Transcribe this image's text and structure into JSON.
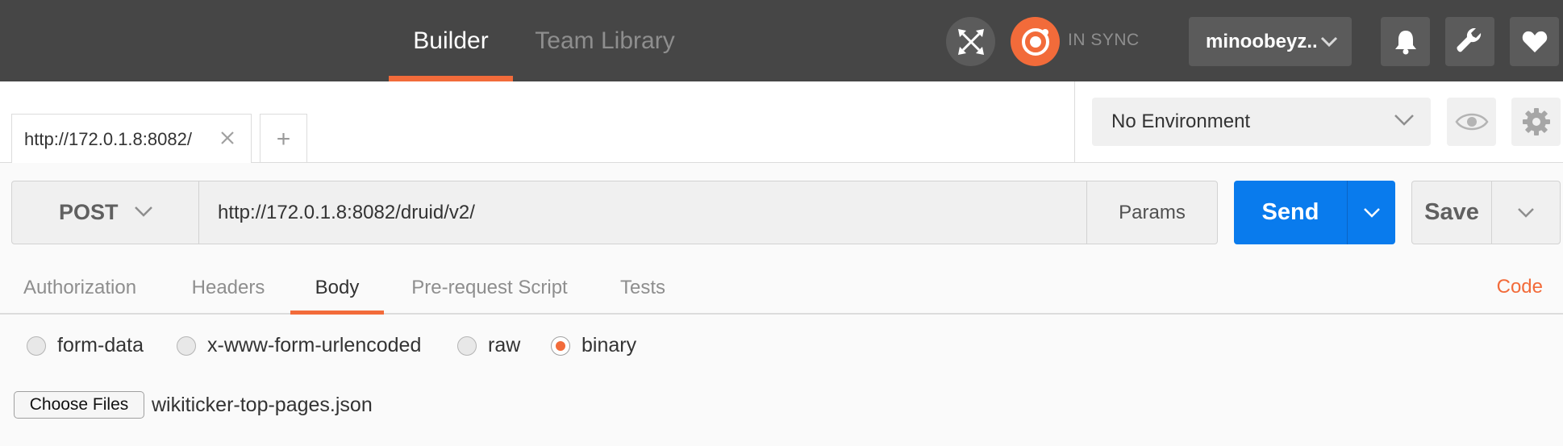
{
  "header": {
    "tabs": [
      "Builder",
      "Team Library"
    ],
    "sync_status": "IN SYNC",
    "user": "minoobeyz..",
    "colors": {
      "bg": "#464646",
      "accent": "#f26b3a"
    }
  },
  "request_tabs": {
    "active_tab": "http://172.0.1.8:8082/",
    "add_label": "+"
  },
  "environment": {
    "selected": "No Environment"
  },
  "request": {
    "method": "POST",
    "url": "http://172.0.1.8:8082/druid/v2/",
    "params_label": "Params",
    "send_label": "Send",
    "save_label": "Save",
    "send_color": "#097bed"
  },
  "subtabs": {
    "items": [
      "Authorization",
      "Headers",
      "Body",
      "Pre-request Script",
      "Tests"
    ],
    "active": "Body",
    "code_label": "Code"
  },
  "body": {
    "options": [
      "form-data",
      "x-www-form-urlencoded",
      "raw",
      "binary"
    ],
    "selected": "binary",
    "choose_files_label": "Choose Files",
    "file_name": "wikiticker-top-pages.json"
  }
}
